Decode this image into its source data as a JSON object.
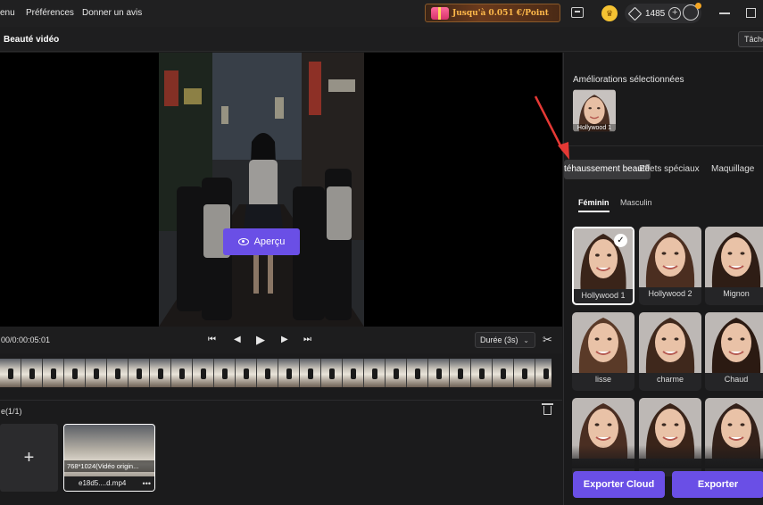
{
  "menu": {
    "items": [
      "enu",
      "Préférences",
      "Donner un avis"
    ]
  },
  "promo": {
    "text": "Jusqu'à 0.051 €/Point"
  },
  "account": {
    "credits": "1485"
  },
  "titlebar": {
    "title": "Beauté vidéo",
    "tasks_label": "Tâche"
  },
  "player": {
    "preview_label": "Aperçu",
    "timecode": "00/0:00:05:01",
    "duration_label": "Durée (3s)",
    "controls": {
      "skip_back": "⏮",
      "prev": "◀",
      "play": "▶",
      "next": "▶",
      "skip_forward": "⏭"
    }
  },
  "files": {
    "count_label": "e(1/1)",
    "add_label": "+",
    "items": [
      {
        "resolution": "768*1024(Vidéo origin...",
        "name": "e18d5....d.mp4"
      }
    ]
  },
  "right_panel": {
    "selected_title": "Améliorations sélectionnées",
    "selected_item": "Hollywood 1",
    "tabs": [
      "téhaussement beauté",
      "Effets spéciaux",
      "Maquillage"
    ],
    "active_tab": "téhaussement beauté",
    "subtabs": [
      "Féminin",
      "Masculin"
    ],
    "active_subtab": "Féminin",
    "styles": [
      {
        "label": "Hollywood 1",
        "selected": true
      },
      {
        "label": "Hollywood 2",
        "selected": false
      },
      {
        "label": "Mignon",
        "selected": false
      },
      {
        "label": "lisse",
        "selected": false
      },
      {
        "label": "charme",
        "selected": false
      },
      {
        "label": "Chaud",
        "selected": false
      },
      {
        "label": "",
        "selected": false
      },
      {
        "label": "",
        "selected": false
      },
      {
        "label": "",
        "selected": false
      }
    ],
    "export_cloud_label": "Exporter Cloud",
    "export_label": "Exporter"
  },
  "colors": {
    "accent": "#6a4fe6",
    "background": "#1b1b1c",
    "annotation_arrow": "#e53935"
  }
}
